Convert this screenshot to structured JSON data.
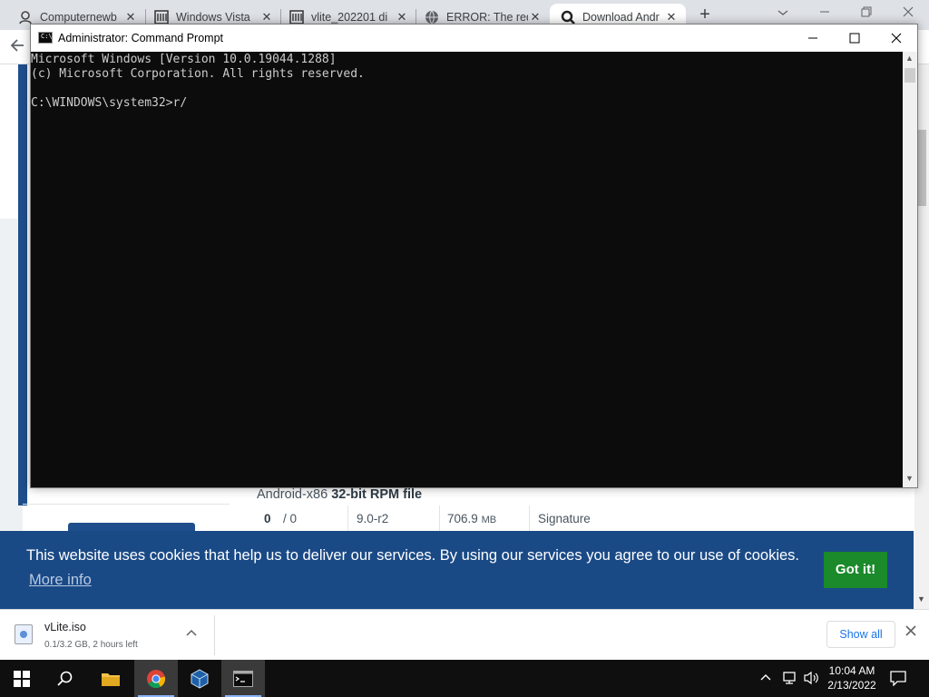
{
  "browser": {
    "tabs": [
      {
        "title": "Computernewb",
        "icon": "user-avatar-icon",
        "active": false
      },
      {
        "title": "Windows Vista",
        "icon": "archive-icon",
        "active": false
      },
      {
        "title": "vlite_202201 di",
        "icon": "archive-icon",
        "active": false
      },
      {
        "title": "ERROR: The req",
        "icon": "globe-icon",
        "active": false
      },
      {
        "title": "Download Andr",
        "icon": "search-logo-icon",
        "active": true
      }
    ],
    "close_glyph": "✕",
    "new_tab_glyph": "+"
  },
  "page": {
    "file_title_prefix": "Android-x86 ",
    "file_title_bold": "32-bit RPM file",
    "file_row": {
      "count": "0",
      "count_sep": "/ 0",
      "version": "9.0-r2",
      "size_value": "706.9",
      "size_unit": "MB",
      "signature": "Signature"
    }
  },
  "cookie_banner": {
    "message": "This website uses cookies that help us to deliver our services. By using our services you agree to our use of cookies.",
    "more_info": "More info",
    "button": "Got it!"
  },
  "downloads": {
    "file_name": "vLite.iso",
    "status": "0.1/3.2 GB, 2 hours left",
    "show_all": "Show all"
  },
  "cmd": {
    "title": "Administrator: Command Prompt",
    "icon_text": "C:\\_",
    "lines": [
      "Microsoft Windows [Version 10.0.19044.1288]",
      "(c) Microsoft Corporation. All rights reserved.",
      "",
      "C:\\WINDOWS\\system32>r/"
    ]
  },
  "taskbar": {
    "time": "10:04 AM",
    "date": "2/13/2022",
    "items": [
      "start-icon",
      "search-icon",
      "file-explorer-icon",
      "chrome-icon",
      "virtualbox-icon",
      "command-prompt-icon"
    ]
  },
  "colors": {
    "cookie_bg": "#1a4a86",
    "cookie_button": "#1a8a2a",
    "console_bg": "#0c0c0c",
    "console_text": "#cccccc"
  }
}
